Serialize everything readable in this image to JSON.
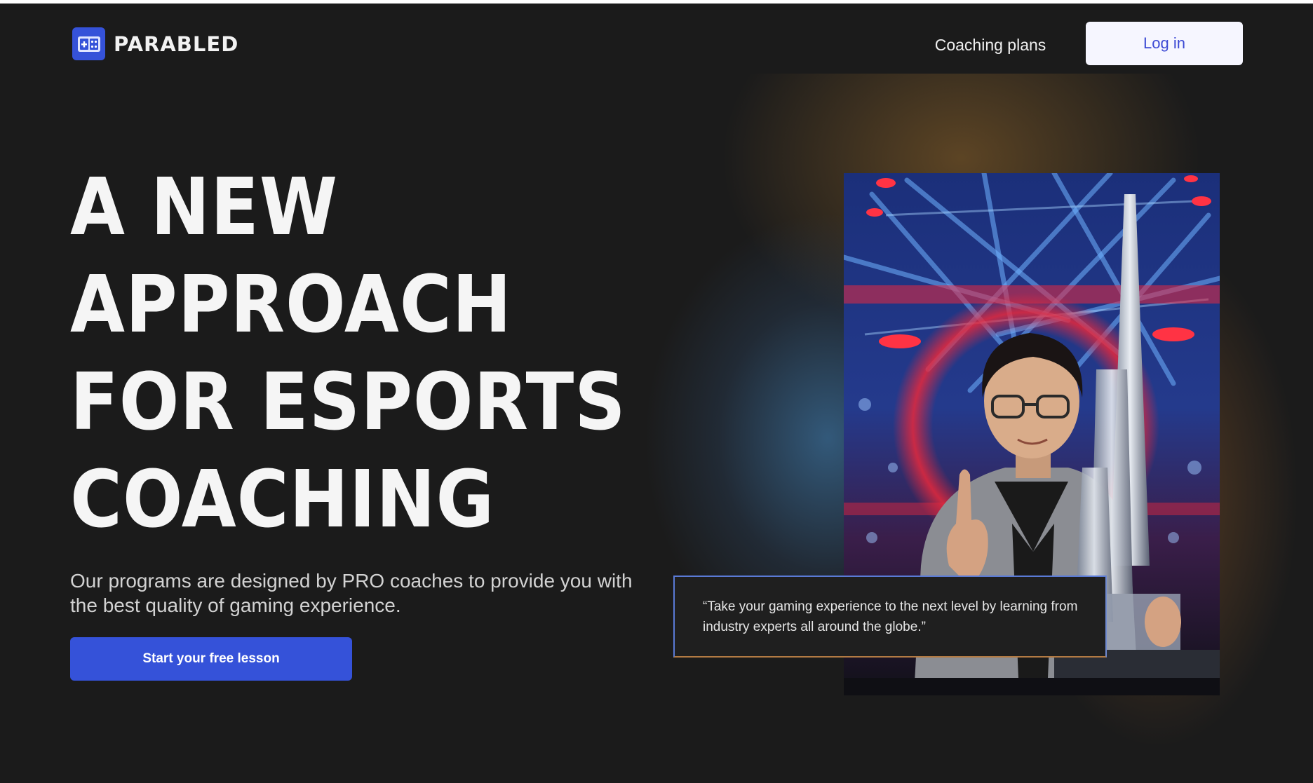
{
  "nav": {
    "brand": "PARABLED",
    "coaching_plans_label": "Coaching plans",
    "login_label": "Log in",
    "logo_icon": "gamepad-logo-icon"
  },
  "hero": {
    "headline_lines": [
      "A NEW",
      "APPROACH",
      "FOR ESPORTS",
      "COACHING"
    ],
    "subtitle": "Our programs are designed by PRO coaches to provide you with the best quality of gaming experience.",
    "cta_label": "Start your free lesson",
    "quote": "“Take your gaming experience to the next level by learning from industry experts all around the globe.”"
  },
  "colors": {
    "background": "#1b1b1b",
    "accent": "#3552d9",
    "login_text": "#3d4ad4",
    "login_bg": "#f6f6ff"
  }
}
